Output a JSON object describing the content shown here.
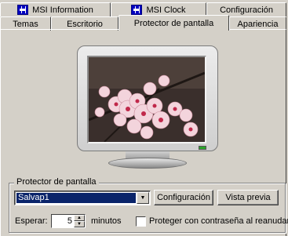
{
  "tabs_row1": [
    {
      "label": "MSI Information",
      "icon": "msi-chip-icon"
    },
    {
      "label": "MSI Clock",
      "icon": "msi-chip-icon"
    },
    {
      "label": "Configuración"
    }
  ],
  "tabs_row2": [
    {
      "label": "Temas"
    },
    {
      "label": "Escritorio"
    },
    {
      "label": "Protector de pantalla",
      "active": true
    },
    {
      "label": "Apariencia"
    }
  ],
  "screensaver": {
    "group_label": "Protector de pantalla",
    "selected": "Salvap1",
    "settings_button": "Configuración",
    "preview_button": "Vista previa",
    "wait_label": "Esperar:",
    "wait_value": "5",
    "wait_units": "minutos",
    "password_label": "Proteger con contraseña al reanudar",
    "password_checked": false
  },
  "preview_image": "cherry-blossom-photo"
}
